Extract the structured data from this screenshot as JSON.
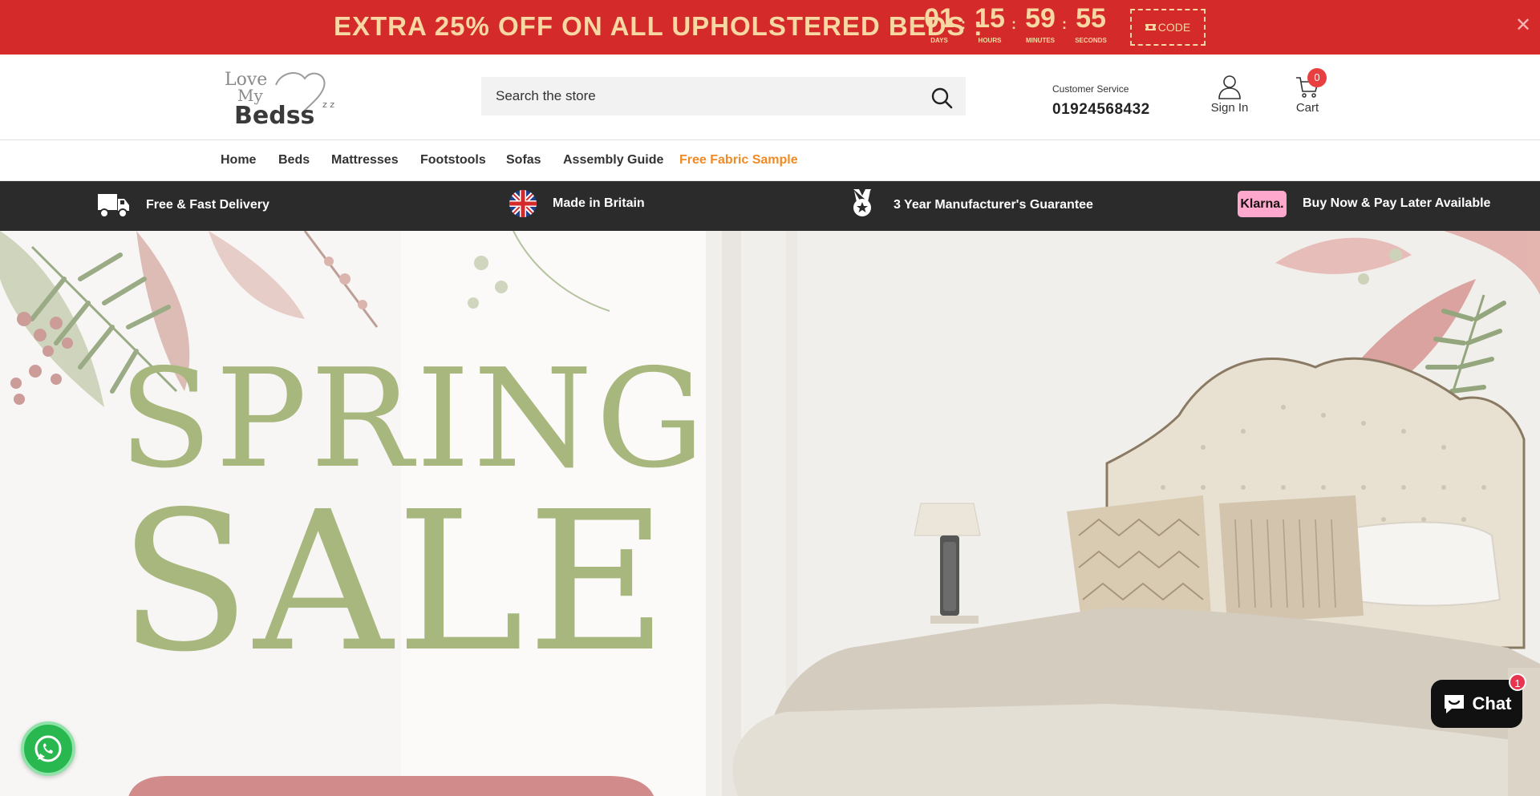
{
  "promo": {
    "text": "EXTRA 25% OFF ON ALL UPHOLSTERED BEDS :",
    "countdown": [
      {
        "value": "01",
        "label": "DAYS"
      },
      {
        "value": "15",
        "label": "HOURS"
      },
      {
        "value": "59",
        "label": "MINUTES"
      },
      {
        "value": "55",
        "label": "SECONDS"
      }
    ],
    "separator": ":",
    "code_label": "CODE",
    "close_glyph": "✕"
  },
  "header": {
    "logo_text": {
      "line1": "Love",
      "line2": "My",
      "line3": "Bedss",
      "zz": "z z"
    },
    "search_placeholder": "Search the store",
    "customer_service_label": "Customer Service",
    "phone": "01924568432",
    "sign_in_label": "Sign In",
    "cart_label": "Cart",
    "cart_count": "0"
  },
  "nav": {
    "items": [
      {
        "label": "Home"
      },
      {
        "label": "Beds"
      },
      {
        "label": "Mattresses"
      },
      {
        "label": "Footstools"
      },
      {
        "label": "Sofas"
      },
      {
        "label": "Assembly Guide"
      },
      {
        "label": "Free Fabric Sample"
      }
    ],
    "highlight_color": "#f08a24"
  },
  "benefits": [
    {
      "icon": "delivery-truck-icon",
      "text": "Free & Fast Delivery"
    },
    {
      "icon": "uk-flag-icon",
      "text": "Made in Britain"
    },
    {
      "icon": "award-ribbon-icon",
      "text": "3 Year Manufacturer's Guarantee"
    },
    {
      "icon": "klarna-logo",
      "badge": "Klarna.",
      "text": "Buy Now & Pay Later Available"
    }
  ],
  "hero": {
    "line1": "SPRING",
    "line2": "SALE"
  },
  "widgets": {
    "chat_label": "Chat",
    "chat_badge": "1",
    "whatsapp_icon": "whatsapp-icon"
  },
  "colors": {
    "promo_bg": "#d42a2a",
    "promo_text": "#f7d8a3",
    "benefits_bg": "#2b2b2b",
    "hero_title": "#a8b77d",
    "cart_badge": "#e84040",
    "klarna_pink": "#ffa8cd"
  }
}
